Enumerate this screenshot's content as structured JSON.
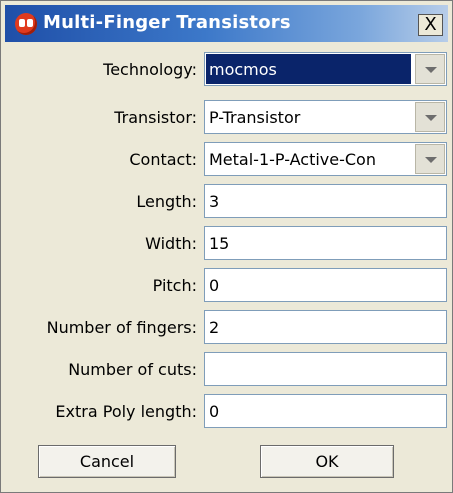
{
  "window": {
    "title": "Multi-Finger Transistors",
    "close_label": "X"
  },
  "form": {
    "technology": {
      "label": "Technology:",
      "value": "mocmos"
    },
    "transistor": {
      "label": "Transistor:",
      "value": "P-Transistor"
    },
    "contact": {
      "label": "Contact:",
      "value": "Metal-1-P-Active-Con"
    },
    "length": {
      "label": "Length:",
      "value": "3"
    },
    "width": {
      "label": "Width:",
      "value": "15"
    },
    "pitch": {
      "label": "Pitch:",
      "value": "0"
    },
    "fingers": {
      "label": "Number of fingers:",
      "value": "2"
    },
    "cuts": {
      "label": "Number of cuts:",
      "value": ""
    },
    "extra_poly": {
      "label": "Extra Poly length:",
      "value": "0"
    }
  },
  "buttons": {
    "cancel": "Cancel",
    "ok": "OK"
  },
  "colors": {
    "selection": "#0a246a",
    "dialog_bg": "#ece9d8",
    "titlebar_start": "#1f4fa8"
  },
  "icons": {
    "app": "electric-app-icon",
    "close": "close-icon",
    "dropdown": "chevron-down-icon"
  }
}
